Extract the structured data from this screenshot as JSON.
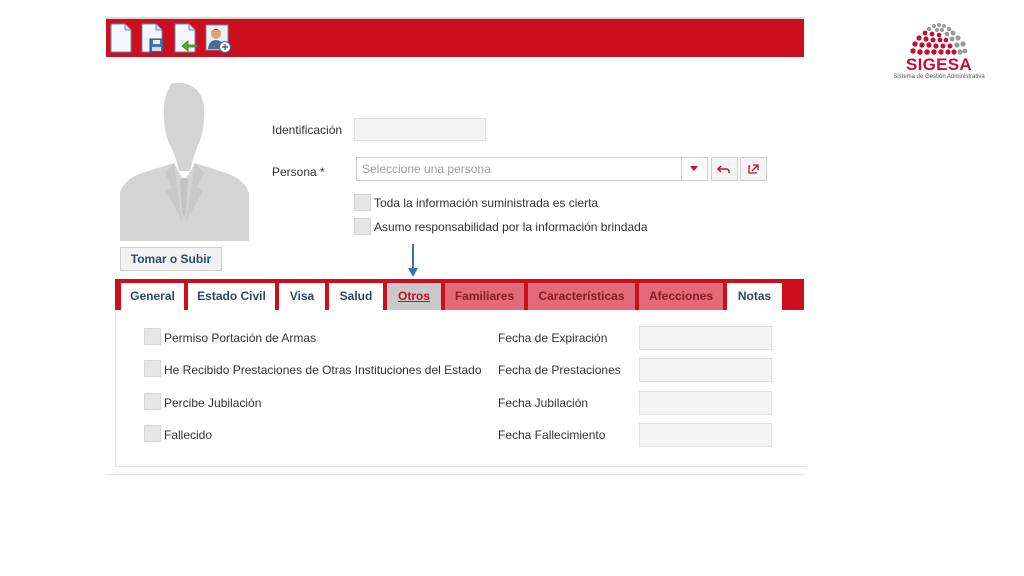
{
  "toolbar": {
    "buttons": [
      {
        "icon": "new-document-icon"
      },
      {
        "icon": "save-document-icon"
      },
      {
        "icon": "export-document-icon"
      },
      {
        "icon": "add-person-icon"
      }
    ],
    "color": "#cc0e1f"
  },
  "logo": {
    "name": "SIGESA",
    "subtitle": "Sistema de Gestión Administrativa"
  },
  "photo": {
    "button_label": "Tomar o Subir"
  },
  "form": {
    "identificacion_label": "Identificación",
    "identificacion_value": "",
    "persona_label": "Persona *",
    "persona_placeholder": "Seleccione una persona",
    "checks": [
      {
        "label": "Toda la información suministrada es cierta",
        "checked": false
      },
      {
        "label": "Asumo responsabilidad por la información brindada",
        "checked": false
      }
    ]
  },
  "tabs": [
    {
      "label": "General",
      "state": "normal"
    },
    {
      "label": "Estado Civil",
      "state": "normal"
    },
    {
      "label": "Visa",
      "state": "normal"
    },
    {
      "label": "Salud",
      "state": "normal"
    },
    {
      "label": "Otros",
      "state": "active"
    },
    {
      "label": "Familiares",
      "state": "light"
    },
    {
      "label": "Características",
      "state": "light"
    },
    {
      "label": "Afecciones",
      "state": "light"
    },
    {
      "label": "Notas",
      "state": "normal"
    }
  ],
  "otros": {
    "rows": [
      {
        "check_label": "Permiso Portación de Armas",
        "date_label": "Fecha de Expiración",
        "date_value": ""
      },
      {
        "check_label": "He Recibido Prestaciones de Otras Instituciones del Estado",
        "date_label": "Fecha de Prestaciones",
        "date_value": ""
      },
      {
        "check_label": "Percibe Jubilación",
        "date_label": "Fecha Jubilación",
        "date_value": ""
      },
      {
        "check_label": "Fallecido",
        "date_label": "Fecha Fallecimiento",
        "date_value": ""
      }
    ]
  }
}
